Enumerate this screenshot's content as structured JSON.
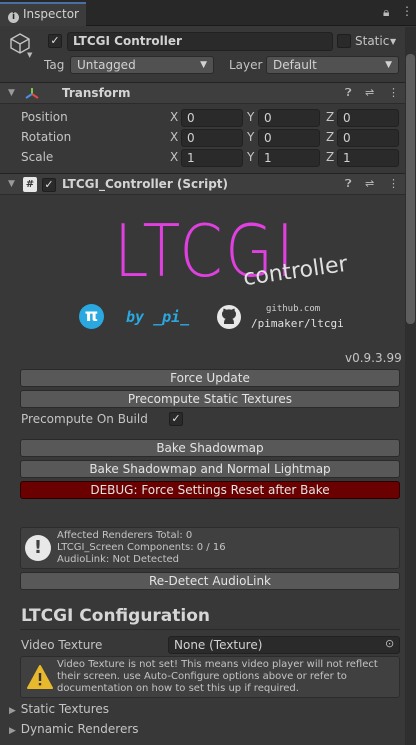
{
  "tab": {
    "label": "Inspector"
  },
  "object": {
    "name": "LTCGI Controller",
    "static_label": "Static",
    "tag_label": "Tag",
    "tag_value": "Untagged",
    "layer_label": "Layer",
    "layer_value": "Default"
  },
  "transform": {
    "title": "Transform",
    "rows": [
      {
        "label": "Position",
        "x": "0",
        "y": "0",
        "z": "0"
      },
      {
        "label": "Rotation",
        "x": "0",
        "y": "0",
        "z": "0"
      },
      {
        "label": "Scale",
        "x": "1",
        "y": "1",
        "z": "1"
      }
    ],
    "axis": {
      "x": "X",
      "y": "Y",
      "z": "Z"
    }
  },
  "script": {
    "title": "LTCGI_Controller (Script)"
  },
  "logo": {
    "main": "LTCGI",
    "sub": "controller",
    "by": "by _pi_",
    "github_small": "github.com",
    "github_path": "/pimaker/ltcgi"
  },
  "version": "v0.9.3.99",
  "buttons": {
    "force_update": "Force Update",
    "precompute": "Precompute Static Textures",
    "bake_shadowmap": "Bake Shadowmap",
    "bake_shadowmap_lightmap": "Bake Shadowmap and Normal Lightmap",
    "debug_reset": "DEBUG: Force Settings Reset after Bake",
    "redetect": "Re-Detect AudioLink"
  },
  "precompute_on_build": {
    "label": "Precompute On Build",
    "checked": true
  },
  "info": {
    "line1": "Affected Renderers Total: 0",
    "line2": "LTCGI_Screen Components: 0 / 16",
    "line3": "AudioLink: Not Detected"
  },
  "config": {
    "heading": "LTCGI Configuration",
    "video_texture_label": "Video Texture",
    "video_texture_value": "None (Texture)",
    "warning": "Video Texture is not set! This means video player will not reflect their screen. use Auto-Configure options above or refer to documentation on how to set this up if required.",
    "static_textures": "Static Textures",
    "dynamic_renderers": "Dynamic Renderers"
  },
  "colors": {
    "accent_magenta": "#e040e0",
    "debug_red": "#6b0000",
    "pi_blue": "#2aa8e0"
  }
}
